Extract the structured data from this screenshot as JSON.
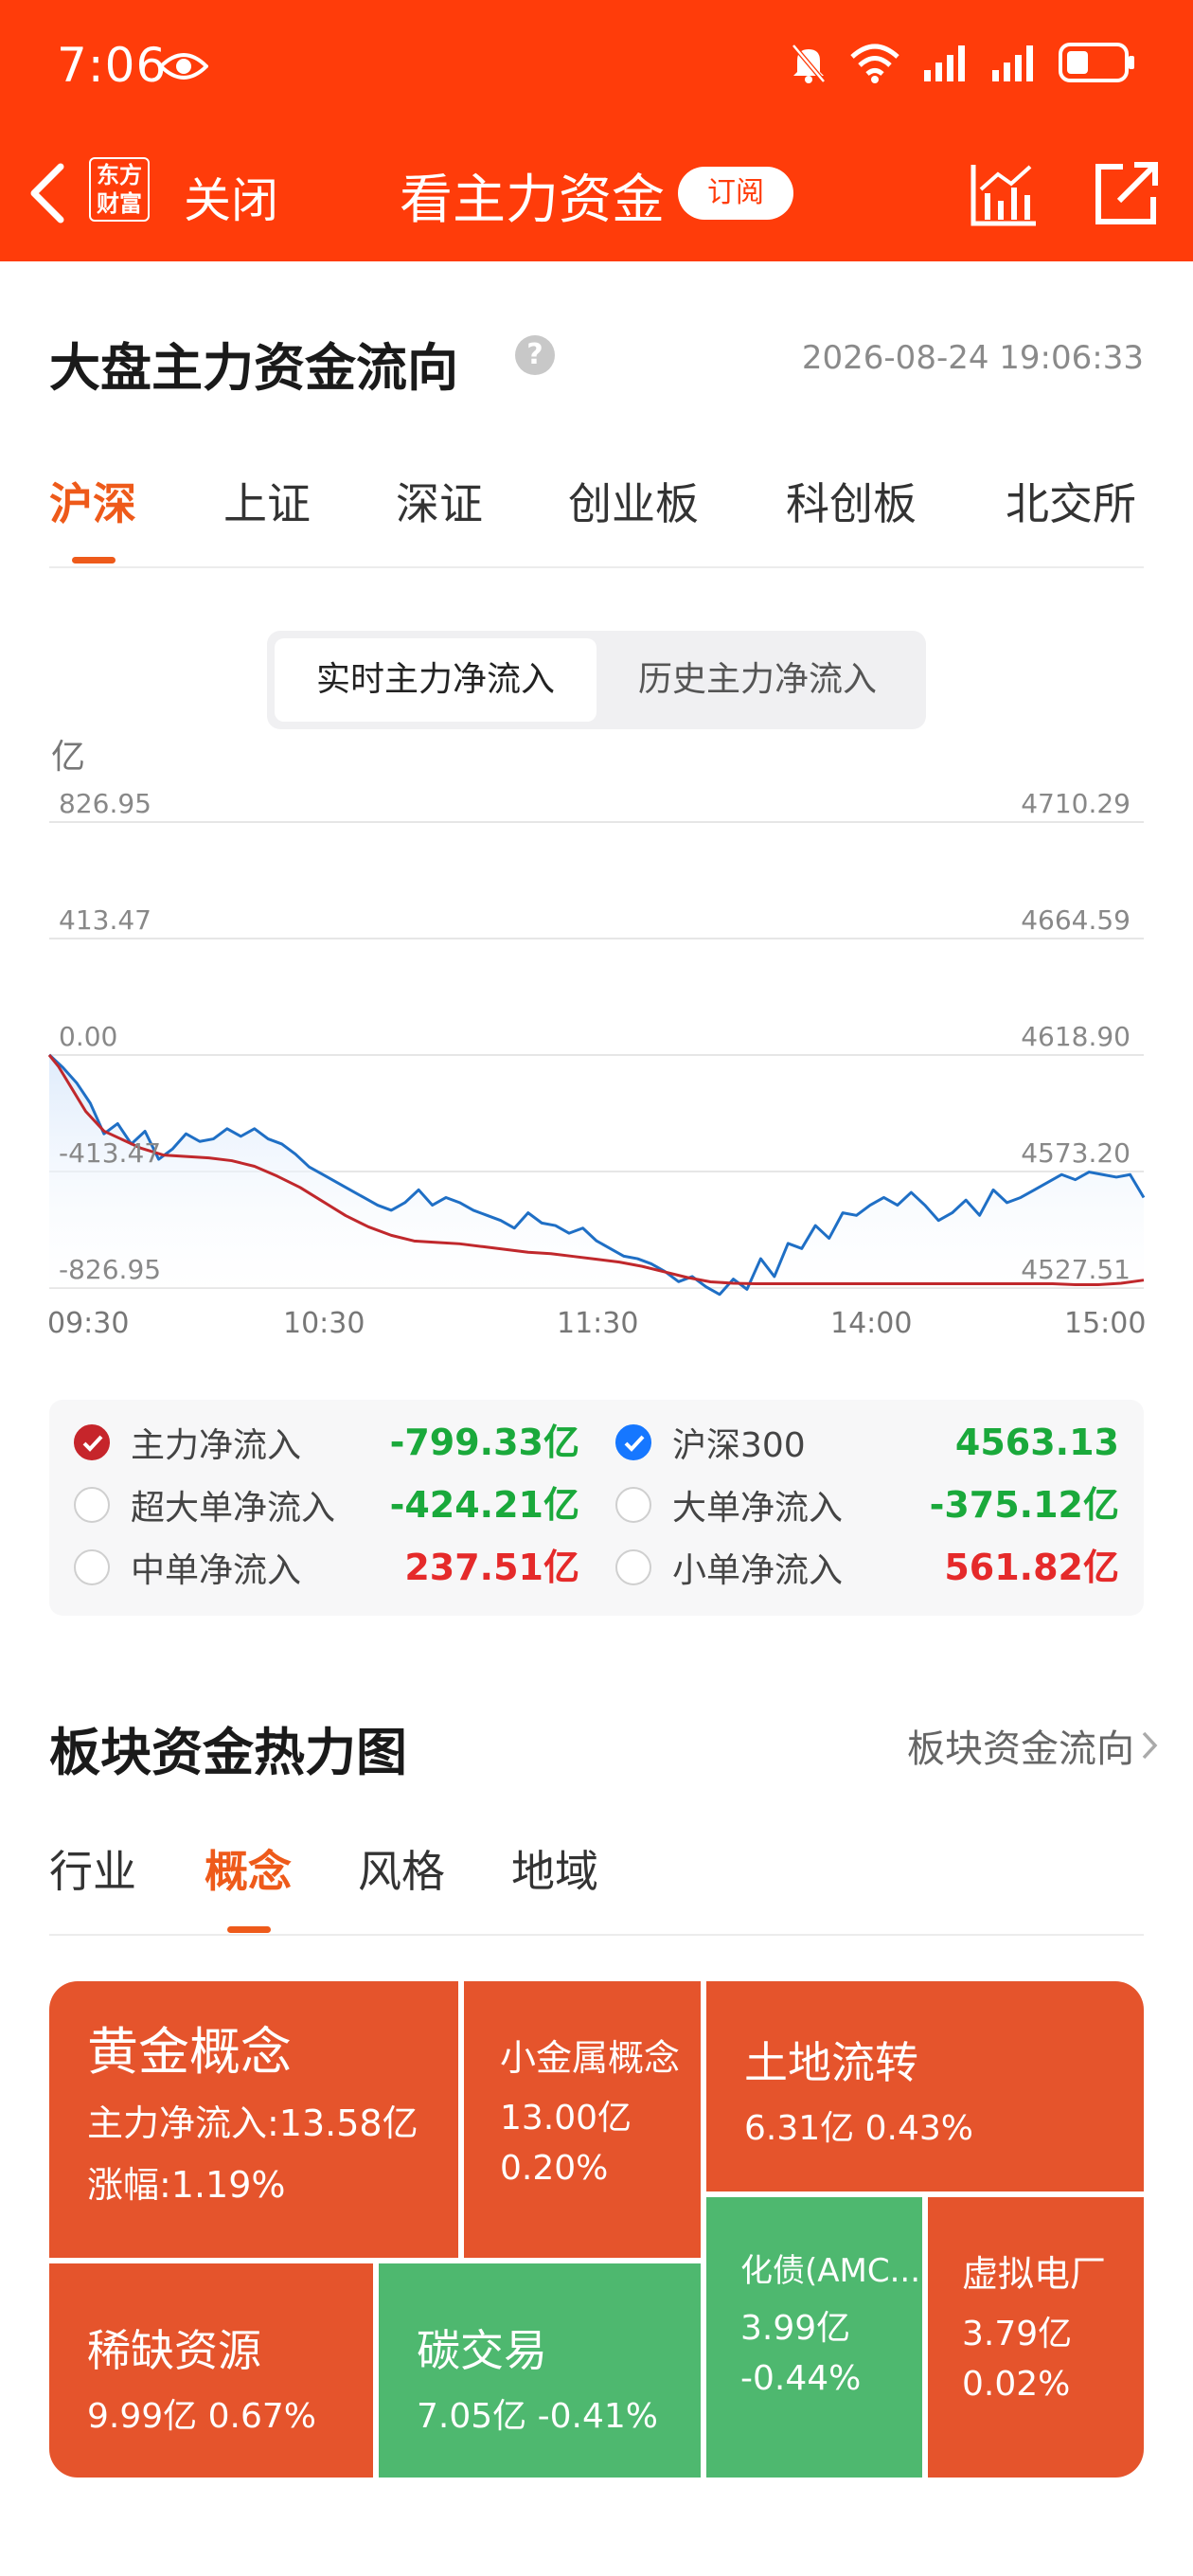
{
  "status_bar": {
    "time": "7:06"
  },
  "nav": {
    "close_label": "关闭",
    "logo_line1": "东方",
    "logo_line2": "财富",
    "title": "看主力资金",
    "subscribe_label": "订阅"
  },
  "flow": {
    "title": "大盘主力资金流向",
    "help": "?",
    "timestamp": "2026-08-24 19:06:33",
    "tabs": [
      "沪深",
      "上证",
      "深证",
      "创业板",
      "科创板",
      "北交所"
    ],
    "active_tab": "沪深",
    "toggle": [
      "实时主力净流入",
      "历史主力净流入"
    ],
    "legend": [
      {
        "name": "主力净流入",
        "value": "-799.33亿",
        "checked": true,
        "color": "#c6252b",
        "trend": "negative"
      },
      {
        "name": "沪深300",
        "value": "4563.13",
        "checked": true,
        "color": "#1677ff",
        "trend": "negative"
      },
      {
        "name": "超大单净流入",
        "value": "-424.21亿",
        "checked": false,
        "trend": "negative"
      },
      {
        "name": "大单净流入",
        "value": "-375.12亿",
        "checked": false,
        "trend": "negative"
      },
      {
        "name": "中单净流入",
        "value": "237.51亿",
        "checked": false,
        "trend": "positive"
      },
      {
        "name": "小单净流入",
        "value": "561.82亿",
        "checked": false,
        "trend": "positive"
      }
    ]
  },
  "chart_data": {
    "type": "line",
    "y_unit": "亿",
    "left_ticks": [
      "826.95",
      "413.47",
      "0.00",
      "-413.47",
      "-826.95"
    ],
    "right_ticks": [
      "4710.29",
      "4664.59",
      "4618.90",
      "4573.20",
      "4527.51"
    ],
    "x_ticks": [
      "09:30",
      "10:30",
      "11:30",
      "14:00",
      "15:00"
    ],
    "ylim_left": [
      -826.95,
      826.95
    ],
    "ylim_right": [
      4527.51,
      4710.29
    ],
    "series": [
      {
        "name": "主力净流入",
        "axis": "left",
        "color": "#c0282c",
        "area_fill": "#dbe9fb",
        "x": [
          0,
          2,
          5,
          8,
          12,
          16,
          20,
          25,
          30,
          35,
          40,
          45,
          50,
          55,
          60,
          65,
          70,
          75,
          80,
          85,
          90,
          95,
          100,
          105,
          110,
          115,
          120,
          125,
          130,
          135,
          140,
          145,
          150,
          155,
          160,
          165,
          170,
          175,
          180,
          185,
          190,
          195,
          200,
          205,
          210,
          215,
          220,
          225,
          230,
          235,
          240
        ],
        "values": [
          0,
          -40,
          -120,
          -200,
          -270,
          -300,
          -330,
          -355,
          -360,
          -365,
          -375,
          -395,
          -430,
          -470,
          -520,
          -570,
          -610,
          -640,
          -660,
          -665,
          -670,
          -680,
          -690,
          -700,
          -705,
          -715,
          -725,
          -735,
          -750,
          -770,
          -790,
          -805,
          -810,
          -812,
          -812,
          -812,
          -812,
          -812,
          -812,
          -812,
          -812,
          -812,
          -812,
          -812,
          -812,
          -812,
          -812,
          -815,
          -815,
          -810,
          -799
        ]
      },
      {
        "name": "沪深300",
        "axis": "right",
        "color": "#1f6fc5",
        "x": [
          0,
          3,
          6,
          9,
          12,
          15,
          18,
          21,
          24,
          27,
          30,
          33,
          36,
          39,
          42,
          45,
          48,
          51,
          54,
          57,
          60,
          63,
          66,
          69,
          72,
          75,
          78,
          81,
          84,
          87,
          90,
          93,
          96,
          99,
          102,
          105,
          108,
          111,
          114,
          117,
          120,
          123,
          126,
          129,
          132,
          135,
          138,
          141,
          144,
          147,
          150,
          153,
          156,
          159,
          162,
          165,
          168,
          171,
          174,
          177,
          180,
          183,
          186,
          189,
          192,
          195,
          198,
          201,
          204,
          207,
          210,
          213,
          216,
          219,
          222,
          225,
          228,
          231,
          234,
          237,
          240
        ],
        "values": [
          4619,
          4614,
          4608,
          4600,
          4588,
          4592,
          4584,
          4589,
          4578,
          4582,
          4588,
          4585,
          4586,
          4590,
          4587,
          4590,
          4586,
          4584,
          4580,
          4575,
          4572,
          4569,
          4566,
          4563,
          4560,
          4558,
          4561,
          4566,
          4560,
          4563,
          4561,
          4558,
          4556,
          4554,
          4551,
          4557,
          4553,
          4552,
          4549,
          4551,
          4546,
          4543,
          4540,
          4539,
          4537,
          4534,
          4530,
          4532,
          4528,
          4525,
          4531,
          4527,
          4539,
          4532,
          4545,
          4543,
          4552,
          4547,
          4557,
          4556,
          4560,
          4563,
          4560,
          4565,
          4560,
          4554,
          4557,
          4562,
          4556,
          4566,
          4561,
          4563,
          4566,
          4569,
          4572,
          4570,
          4573,
          4572,
          4571,
          4572,
          4563
        ]
      }
    ]
  },
  "sectors": {
    "title": "板块资金热力图",
    "link_label": "板块资金流向",
    "tabs": [
      "行业",
      "概念",
      "风格",
      "地域"
    ],
    "active_tab": "概念",
    "tiles": [
      {
        "name": "黄金概念",
        "line1": "主力净流入:13.58亿",
        "line2": "涨幅:1.19%",
        "color": "orange"
      },
      {
        "name": "小金属概念",
        "line1": "13.00亿",
        "line2": "0.20%",
        "color": "orange"
      },
      {
        "name": "土地流转",
        "line1": "6.31亿  0.43%",
        "color": "orange"
      },
      {
        "name": "稀缺资源",
        "line1": "9.99亿  0.67%",
        "color": "orange"
      },
      {
        "name": "碳交易",
        "line1": "7.05亿  -0.41%",
        "color": "green"
      },
      {
        "name": "化债(AMC...",
        "line1": "3.99亿",
        "line2": "-0.44%",
        "color": "green"
      },
      {
        "name": "虚拟电厂",
        "line1": "3.79亿",
        "line2": "0.02%",
        "color": "orange"
      }
    ]
  }
}
